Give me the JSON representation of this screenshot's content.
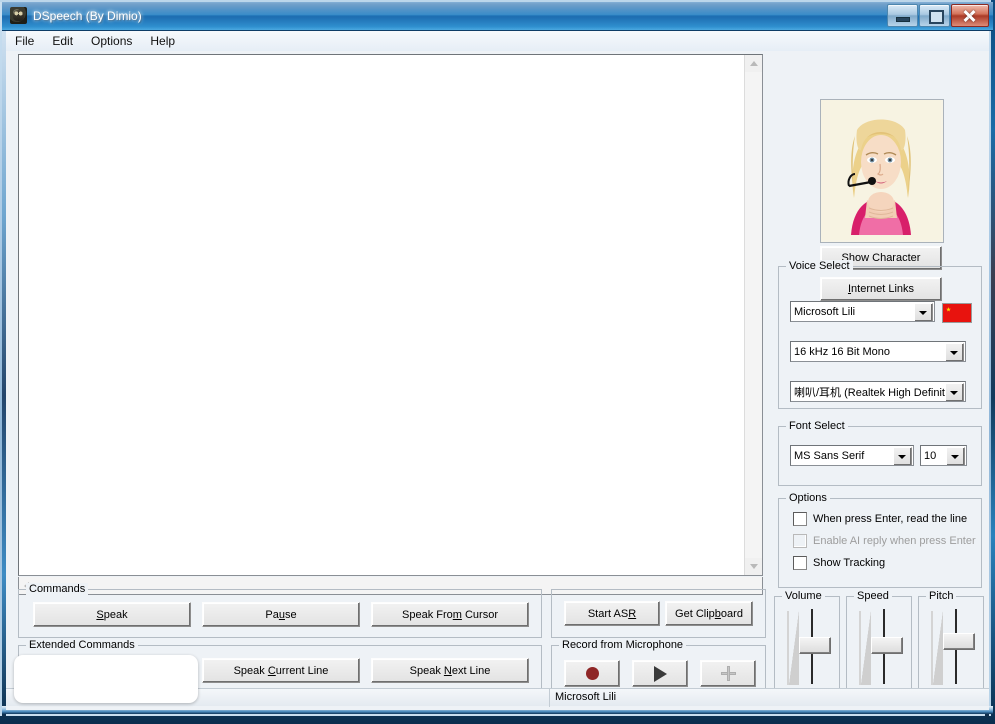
{
  "window": {
    "title": "DSpeech (By Dimio)",
    "app_icon": "app-icon",
    "controls": {
      "minimize": "minimize-icon",
      "restore": "restore-icon",
      "close": "close-icon"
    }
  },
  "menubar": {
    "items": [
      "File",
      "Edit",
      "Options",
      "Help"
    ]
  },
  "editor": {
    "text": "",
    "placeholder": ""
  },
  "character": {
    "show_character_label": "Show Character",
    "internet_links_label": "Internet Links",
    "image_alt": "character-avatar"
  },
  "voice_select": {
    "title": "Voice Select",
    "voice": "Microsoft Lili",
    "format": "16 kHz 16 Bit Mono",
    "device": "喇叭/耳机 (Realtek High Definiti",
    "flag": "flag-china",
    "flag_color": "#e8130e"
  },
  "font_select": {
    "title": "Font Select",
    "font": "MS Sans Serif",
    "size": "10"
  },
  "options": {
    "title": "Options",
    "items": [
      {
        "label": "When press Enter, read the line",
        "checked": false,
        "disabled": false
      },
      {
        "label": "Enable AI reply when press Enter",
        "checked": false,
        "disabled": true
      },
      {
        "label": "Show Tracking",
        "checked": false,
        "disabled": false
      }
    ]
  },
  "commands": {
    "title": "Commands",
    "speak": "Speak",
    "pause": "Pause",
    "speak_from_cursor": "Speak From Cursor"
  },
  "extended_commands": {
    "title": "Extended Commands",
    "speak_current_line": "Speak Current Line",
    "speak_next_line": "Speak Next Line"
  },
  "asr": {
    "start_asr": "Start ASR",
    "get_clipboard": "Get Clipboard"
  },
  "record": {
    "title": "Record from Microphone",
    "record_icon": "record-circle-icon",
    "play_icon": "play-triangle-icon",
    "add_icon": "plus-icon",
    "record_color": "#8f2626"
  },
  "sliders": [
    {
      "title": "Volume",
      "value": 50
    },
    {
      "title": "Speed",
      "value": 50
    },
    {
      "title": "Pitch",
      "value": 50
    }
  ],
  "statusbar": {
    "left": "",
    "right": "Microsoft Lili"
  },
  "popup": {
    "text": ""
  }
}
